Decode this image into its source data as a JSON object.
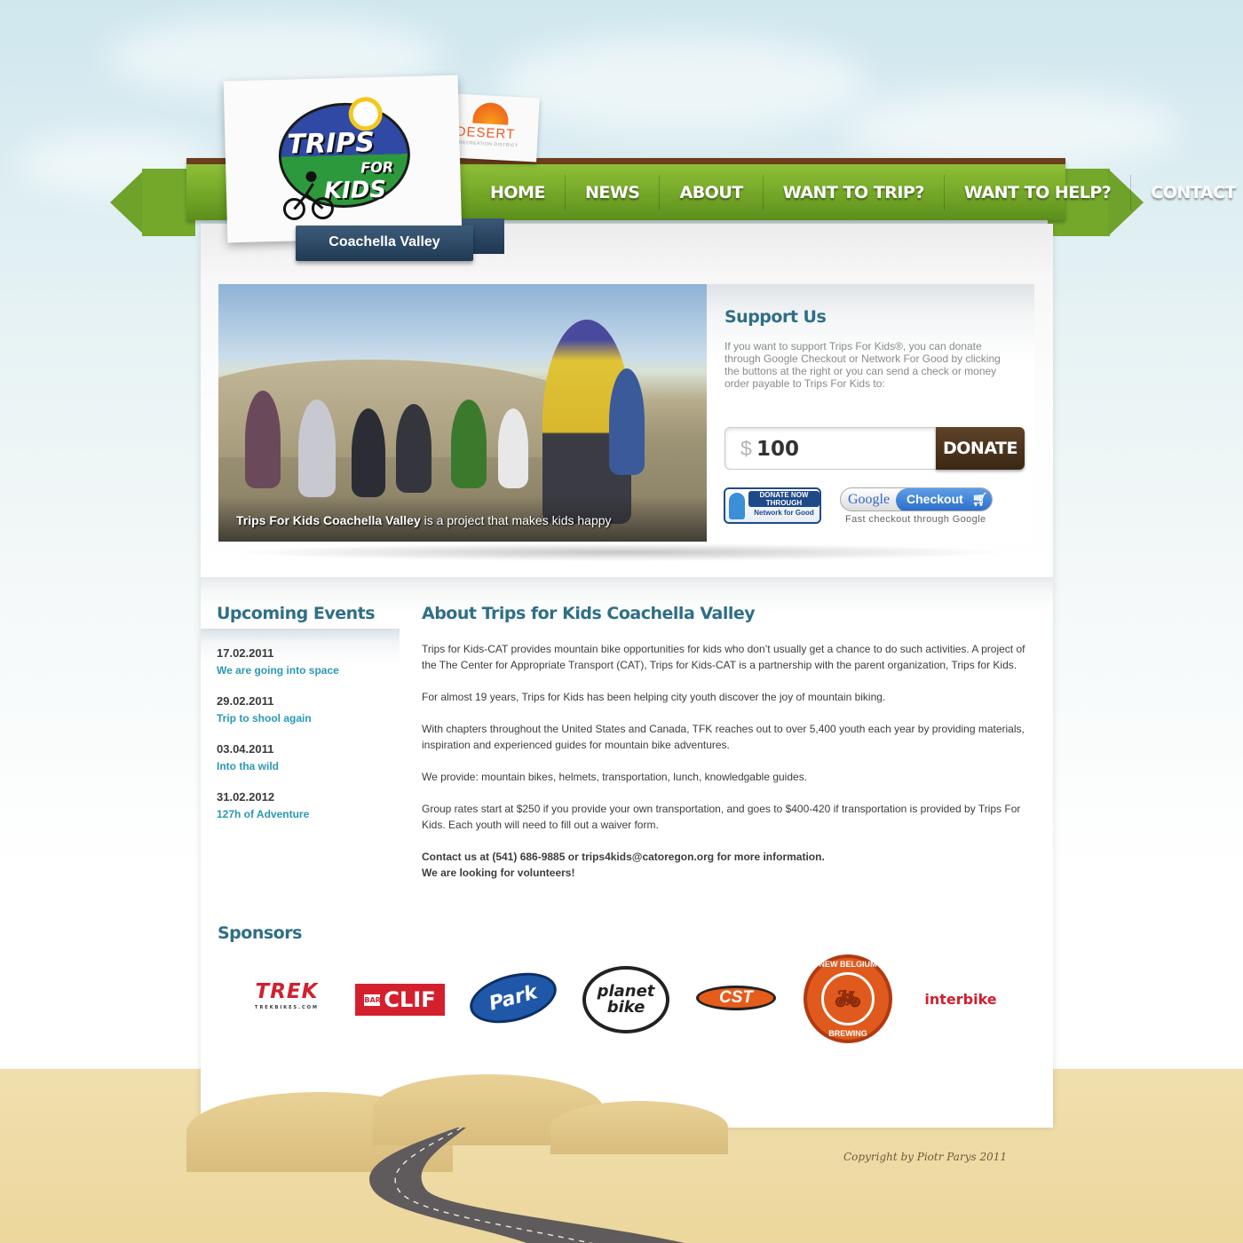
{
  "nav": {
    "items": [
      "HOME",
      "NEWS",
      "ABOUT",
      "WANT TO TRIP?",
      "WANT TO HELP?",
      "CONTACT"
    ]
  },
  "logo": {
    "trips": "TRIPS",
    "for": "FOR",
    "kids": "KIDS",
    "partner_word": "DESERT",
    "partner_sub": "RECREATION DISTRICT"
  },
  "region": "Coachella Valley",
  "hero": {
    "caption_bold": "Trips For Kids Coachella Valley",
    "caption_rest": " is a project that makes kids happy"
  },
  "support": {
    "title": "Support Us",
    "text": "If you want to support Trips For Kids®, you can donate through Google Checkout or Network For Good by clicking the buttons at the right or you can send a check or money order payable to Trips For Kids to:",
    "currency": "$",
    "amount": "100",
    "donate_label": "DONATE",
    "nfg_top": "DONATE NOW THROUGH",
    "nfg_bottom": "Network for Good",
    "google_word": "Google",
    "checkout_label": "Checkout",
    "checkout_caption": "Fast checkout through Google"
  },
  "events": {
    "title": "Upcoming Events",
    "items": [
      {
        "date": "17.02.2011",
        "title": "We are going into space"
      },
      {
        "date": "29.02.2011",
        "title": "Trip to shool again"
      },
      {
        "date": "03.04.2011",
        "title": "Into tha wild"
      },
      {
        "date": "31.02.2012",
        "title": "127h of Adventure"
      }
    ]
  },
  "about": {
    "title": "About Trips for Kids Coachella Valley",
    "paragraphs": [
      "Trips for Kids-CAT provides mountain bike opportunities for kids who don’t usually get a chance to do such activities. A project of the The Center for Appropriate Transport (CAT), Trips for Kids-CAT is a partnership with the parent organization, Trips for Kids.",
      "For almost 19 years, Trips for Kids has been helping city youth discover the joy of mountain biking.",
      "With chapters throughout the United States and Canada, TFK reaches out to over 5,400 youth each year by providing materials, inspiration and experienced guides for mountain bike adventures.",
      "We provide: mountain bikes, helmets, transportation, lunch, knowledgable guides.",
      "Group rates start at  $250 if you provide your own transportation, and goes to $400-420 if transportation is provided by Trips For Kids. Each youth will need to fill out a waiver form."
    ],
    "contact": "Contact us at (541) 686-9885 or trips4kids@catoregon.org for more information.",
    "volunteers": "We are looking for volunteers!"
  },
  "sponsors": {
    "title": "Sponsors",
    "trek": "TREK",
    "trek_sub": "TREKBIKES.COM",
    "clif_bar": "BAR",
    "clif": "CLIF",
    "park": "Park",
    "planet_1": "planet",
    "planet_2": "bike",
    "cst": "CST",
    "nb_top": "NEW BELGIUM",
    "nb_bottom": "BREWING",
    "interbike": "interbike"
  },
  "footer": {
    "copyright": "Copyright by Piotr Parys 2011"
  },
  "colors": {
    "accent_green": "#78ab2a",
    "title_teal": "#2f6f86",
    "link_blue": "#2a98b5",
    "donate_brown": "#4a331c"
  }
}
